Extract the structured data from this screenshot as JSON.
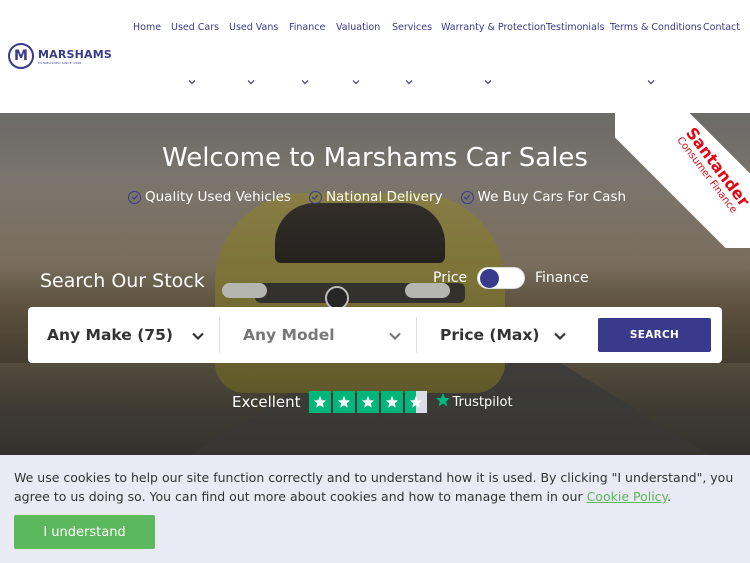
{
  "brand": {
    "logo_letter": "M",
    "name": "MARSHAMS",
    "tagline": "ESTABLISHED SINCE 1998",
    "color": "#3a3a8c"
  },
  "nav": {
    "items": [
      {
        "label": "Home",
        "has_dropdown": false
      },
      {
        "label": "Used Cars",
        "has_dropdown": true
      },
      {
        "label": "Used Vans",
        "has_dropdown": true
      },
      {
        "label": "Finance",
        "has_dropdown": true
      },
      {
        "label": "Valuation",
        "has_dropdown": true
      },
      {
        "label": "Services",
        "has_dropdown": true
      },
      {
        "label": "Warranty & Protection",
        "has_dropdown": true
      },
      {
        "label": "Testimonials",
        "has_dropdown": false
      },
      {
        "label": "Terms & Conditions",
        "has_dropdown": true
      },
      {
        "label": "Contact",
        "has_dropdown": false
      }
    ],
    "dropdown_icon": "chevron-down-icon"
  },
  "hero": {
    "title": "Welcome to Marshams Car Sales",
    "features": [
      {
        "label": "Quality Used Vehicles",
        "icon": "check-circle-icon"
      },
      {
        "label": "National Delivery",
        "icon": "check-circle-icon"
      },
      {
        "label": "We Buy Cars For Cash",
        "icon": "check-circle-icon"
      }
    ],
    "ribbon": {
      "brand": "Santander",
      "sub": "Consumer Finance",
      "color": "#e30613"
    }
  },
  "search": {
    "heading": "Search Our Stock",
    "toggle": {
      "left_label": "Price",
      "right_label": "Finance",
      "selected": "Price"
    },
    "make": "Any Make (75)",
    "model": "Any Model",
    "price": "Price (Max)",
    "button_label": "SEARCH"
  },
  "trustpilot": {
    "label": "Excellent",
    "rating_stars": 4.5,
    "brand": "Trustpilot",
    "color": "#00b67a"
  },
  "cookie": {
    "text": "We use cookies to help our site function correctly and to understand how it is used. By clicking \"I understand\", you agree to us doing so. You can find out more about cookies and how to manage them in our ",
    "link": "Cookie Policy",
    "after": ".",
    "button": "I understand",
    "button_color": "#5cb85c"
  }
}
